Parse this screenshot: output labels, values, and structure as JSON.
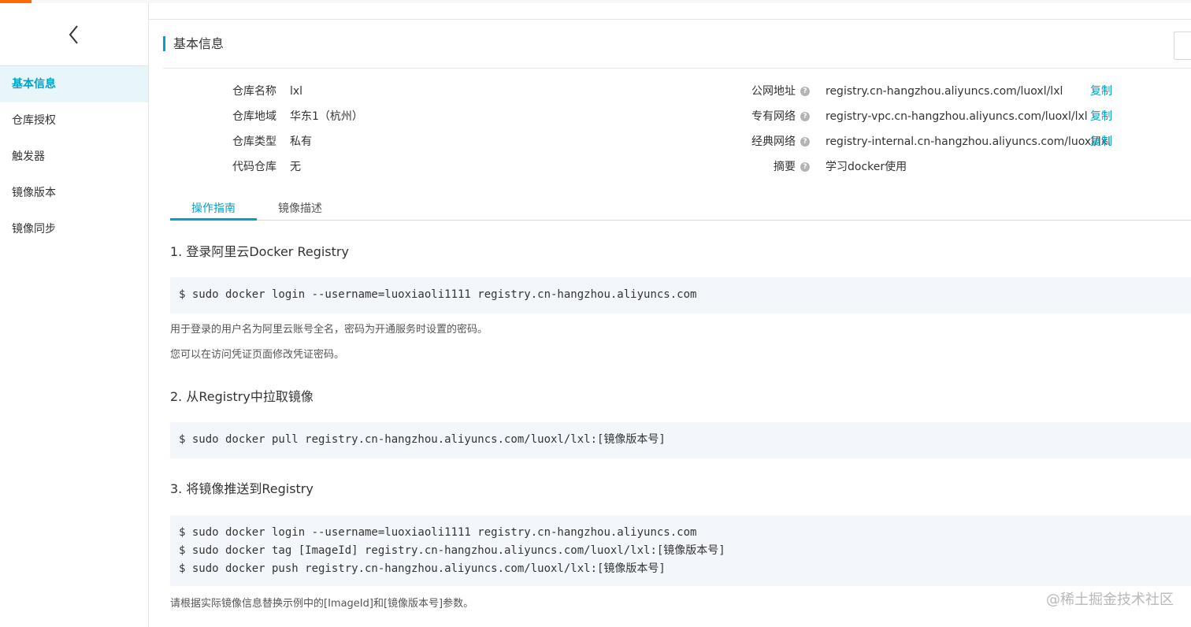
{
  "sidebar": {
    "items": [
      {
        "label": "基本信息",
        "active": true
      },
      {
        "label": "仓库授权"
      },
      {
        "label": "触发器"
      },
      {
        "label": "镜像版本"
      },
      {
        "label": "镜像同步"
      }
    ]
  },
  "section": {
    "title": "基本信息"
  },
  "info_left": [
    {
      "label": "仓库名称",
      "value": "lxl"
    },
    {
      "label": "仓库地域",
      "value": "华东1（杭州）"
    },
    {
      "label": "仓库类型",
      "value": "私有"
    },
    {
      "label": "代码仓库",
      "value": "无"
    }
  ],
  "info_right": [
    {
      "label": "公网地址",
      "value": "registry.cn-hangzhou.aliyuncs.com/luoxl/lxl",
      "action": "复制"
    },
    {
      "label": "专有网络",
      "value": "registry-vpc.cn-hangzhou.aliyuncs.com/luoxl/lxl",
      "action": "复制"
    },
    {
      "label": "经典网络",
      "value": "registry-internal.cn-hangzhou.aliyuncs.com/luoxl/lxl",
      "action": "复制"
    },
    {
      "label": "摘要",
      "value": "学习docker使用"
    }
  ],
  "help_glyph": "?",
  "tabs": [
    {
      "label": "操作指南",
      "active": true
    },
    {
      "label": "镜像描述"
    }
  ],
  "guide": {
    "step1": {
      "title": "1. 登录阿里云Docker Registry",
      "code": [
        "$ sudo docker login --username=luoxiaoli1111 registry.cn-hangzhou.aliyuncs.com"
      ],
      "notes": [
        "用于登录的用户名为阿里云账号全名，密码为开通服务时设置的密码。",
        "您可以在访问凭证页面修改凭证密码。"
      ]
    },
    "step2": {
      "title": "2. 从Registry中拉取镜像",
      "code": [
        "$ sudo docker pull registry.cn-hangzhou.aliyuncs.com/luoxl/lxl:[镜像版本号]"
      ]
    },
    "step3": {
      "title": "3. 将镜像推送到Registry",
      "code": [
        "$ sudo docker login --username=luoxiaoli1111 registry.cn-hangzhou.aliyuncs.com",
        "$ sudo docker tag [ImageId] registry.cn-hangzhou.aliyuncs.com/luoxl/lxl:[镜像版本号]",
        "$ sudo docker push registry.cn-hangzhou.aliyuncs.com/luoxl/lxl:[镜像版本号]"
      ],
      "notes": [
        "请根据实际镜像信息替换示例中的[ImageId]和[镜像版本号]参数。"
      ]
    }
  },
  "watermark": "@稀土掘金技术社区",
  "colors": {
    "accent": "#00a2ca",
    "brand": "#ff6a00",
    "code_bg": "#f3f7fc"
  }
}
